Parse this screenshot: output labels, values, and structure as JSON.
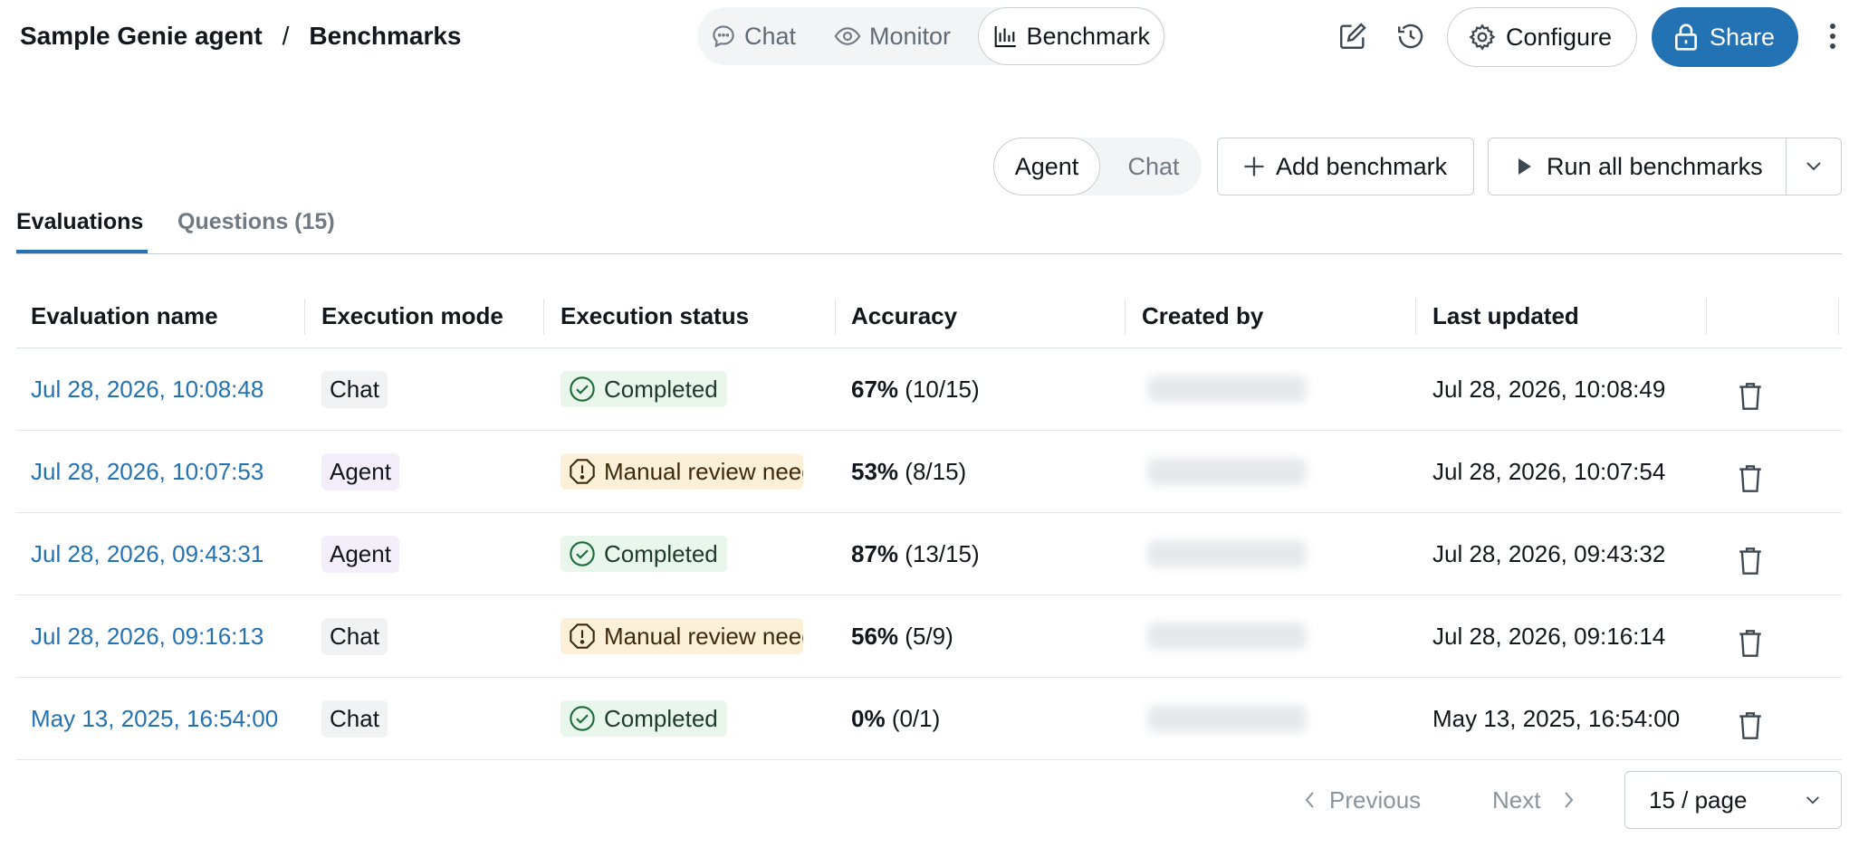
{
  "breadcrumb": {
    "agent": "Sample Genie agent",
    "separator": "/",
    "page": "Benchmarks"
  },
  "mode_tabs": [
    {
      "label": "Chat",
      "icon": "chat-bubble-icon",
      "active": false
    },
    {
      "label": "Monitor",
      "icon": "eye-icon",
      "active": false
    },
    {
      "label": "Benchmark",
      "icon": "bar-chart-icon",
      "active": true
    }
  ],
  "toolbar": {
    "configure_label": "Configure",
    "share_label": "Share",
    "accent": "#2272b4"
  },
  "view_toggle": {
    "options": [
      "Agent",
      "Chat"
    ],
    "selected": "Agent"
  },
  "actions": {
    "add_label": "Add benchmark",
    "run_all_label": "Run all benchmarks"
  },
  "tabs": [
    {
      "label": "Evaluations",
      "active": true
    },
    {
      "label": "Questions (15)",
      "active": false
    }
  ],
  "table": {
    "headers": [
      "Evaluation name",
      "Execution mode",
      "Execution status",
      "Accuracy",
      "Created by",
      "Last updated"
    ],
    "rows": [
      {
        "name": "Jul 28, 2026, 10:08:48",
        "mode": "Chat",
        "status": "Completed",
        "status_kind": "success",
        "acc_pct": "67%",
        "acc_frac": "(10/15)",
        "updated": "Jul 28, 2026, 10:08:49"
      },
      {
        "name": "Jul 28, 2026, 10:07:53",
        "mode": "Agent",
        "status": "Manual review needed",
        "status_kind": "warning",
        "acc_pct": "53%",
        "acc_frac": "(8/15)",
        "updated": "Jul 28, 2026, 10:07:54"
      },
      {
        "name": "Jul 28, 2026, 09:43:31",
        "mode": "Agent",
        "status": "Completed",
        "status_kind": "success",
        "acc_pct": "87%",
        "acc_frac": "(13/15)",
        "updated": "Jul 28, 2026, 09:43:32"
      },
      {
        "name": "Jul 28, 2026, 09:16:13",
        "mode": "Chat",
        "status": "Manual review needed",
        "status_kind": "warning",
        "acc_pct": "56%",
        "acc_frac": "(5/9)",
        "updated": "Jul 28, 2026, 09:16:14"
      },
      {
        "name": "May 13, 2025, 16:54:00",
        "mode": "Chat",
        "status": "Completed",
        "status_kind": "success",
        "acc_pct": "0%",
        "acc_frac": "(0/1)",
        "updated": "May 13, 2025, 16:54:00"
      }
    ]
  },
  "pagination": {
    "previous": "Previous",
    "next": "Next",
    "page_size": "15 / page"
  },
  "colors": {
    "link": "#2272b4",
    "success_bg": "#e9f6ec",
    "warning_bg": "#fdf0d8",
    "agent_tag_bg": "#f4eefb",
    "chat_tag_bg": "#f1f2f3"
  }
}
